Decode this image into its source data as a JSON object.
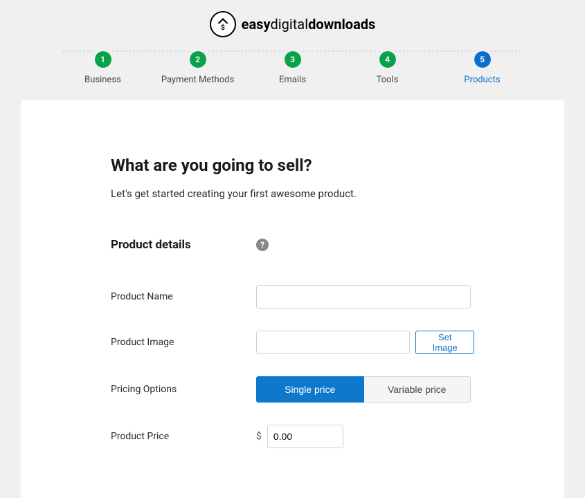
{
  "logo": {
    "prefix": "easy",
    "mid": "digital",
    "suffix": "downloads"
  },
  "stepper": [
    {
      "num": "1",
      "label": "Business",
      "color": "green"
    },
    {
      "num": "2",
      "label": "Payment Methods",
      "color": "green"
    },
    {
      "num": "3",
      "label": "Emails",
      "color": "green"
    },
    {
      "num": "4",
      "label": "Tools",
      "color": "green"
    },
    {
      "num": "5",
      "label": "Products",
      "color": "blue",
      "active": true
    }
  ],
  "page": {
    "title": "What are you going to sell?",
    "subtitle": "Let's get started creating your first awesome product."
  },
  "section": {
    "title": "Product details"
  },
  "fields": {
    "product_name": {
      "label": "Product Name",
      "value": ""
    },
    "product_image": {
      "label": "Product Image",
      "value": "",
      "button": "Set Image"
    },
    "pricing_options": {
      "label": "Pricing Options",
      "single": "Single price",
      "variable": "Variable price"
    },
    "product_price": {
      "label": "Product Price",
      "currency": "$",
      "value": "0.00"
    }
  }
}
